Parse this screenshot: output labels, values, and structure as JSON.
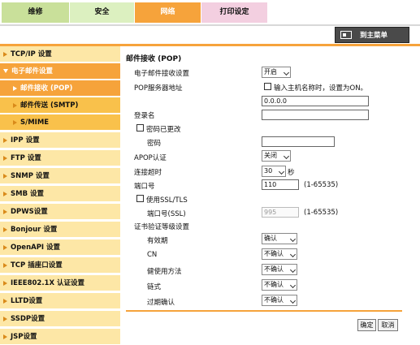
{
  "tabs": {
    "maintenance": "维修",
    "security": "安全",
    "network": "网络",
    "print_settings": "打印设定"
  },
  "main_menu": "到主菜单",
  "sidebar": {
    "items": [
      {
        "label": "TCP/IP 设置"
      },
      {
        "label": "电子邮件设置"
      },
      {
        "label": "邮件接收 (POP)"
      },
      {
        "label": "邮件传送 (SMTP)"
      },
      {
        "label": "S/MIME"
      },
      {
        "label": "IPP 设置"
      },
      {
        "label": "FTP 设置"
      },
      {
        "label": "SNMP 设置"
      },
      {
        "label": "SMB 设置"
      },
      {
        "label": "DPWS设置"
      },
      {
        "label": "Bonjour 设置"
      },
      {
        "label": "OpenAPI 设置"
      },
      {
        "label": "TCP 插座口设置"
      },
      {
        "label": "IEEE802.1X 认证设置"
      },
      {
        "label": "LLTD设置"
      },
      {
        "label": "SSDP设置"
      },
      {
        "label": "JSP设置"
      }
    ]
  },
  "form": {
    "title": "邮件接收 (POP)",
    "email_recv_label": "电子邮件接收设置",
    "email_recv_value": "开启",
    "pop_server_label": "POP服务器地址",
    "hostname_cb_label": "输入主机名称时，设置为ON。",
    "pop_server_value": "0.0.0.0",
    "login_label": "登录名",
    "login_value": "",
    "pw_changed_label": "密码已更改",
    "password_label": "密码",
    "password_value": "",
    "apop_label": "APOP认证",
    "apop_value": "关闭",
    "timeout_label": "连接超时",
    "timeout_value": "30",
    "timeout_unit": "秒",
    "port_label": "端口号",
    "port_value": "110",
    "port_range": "(1-65535)",
    "use_ssl_label": "使用SSL/TLS",
    "ssl_port_label": "端口号(SSL)",
    "ssl_port_value": "995",
    "ssl_port_range": "(1-65535)",
    "cert_level_label": "证书验证等级设置",
    "validity_label": "有效期",
    "validity_value": "确认",
    "cn_label": "CN",
    "cn_value": "不确认",
    "key_usage_label": "健使用方法",
    "key_usage_value": "不确认",
    "chain_label": "链式",
    "chain_value": "不确认",
    "expiry_label": "过期确认",
    "expiry_value": "不确认"
  },
  "buttons": {
    "ok": "确定",
    "cancel": "取消"
  }
}
